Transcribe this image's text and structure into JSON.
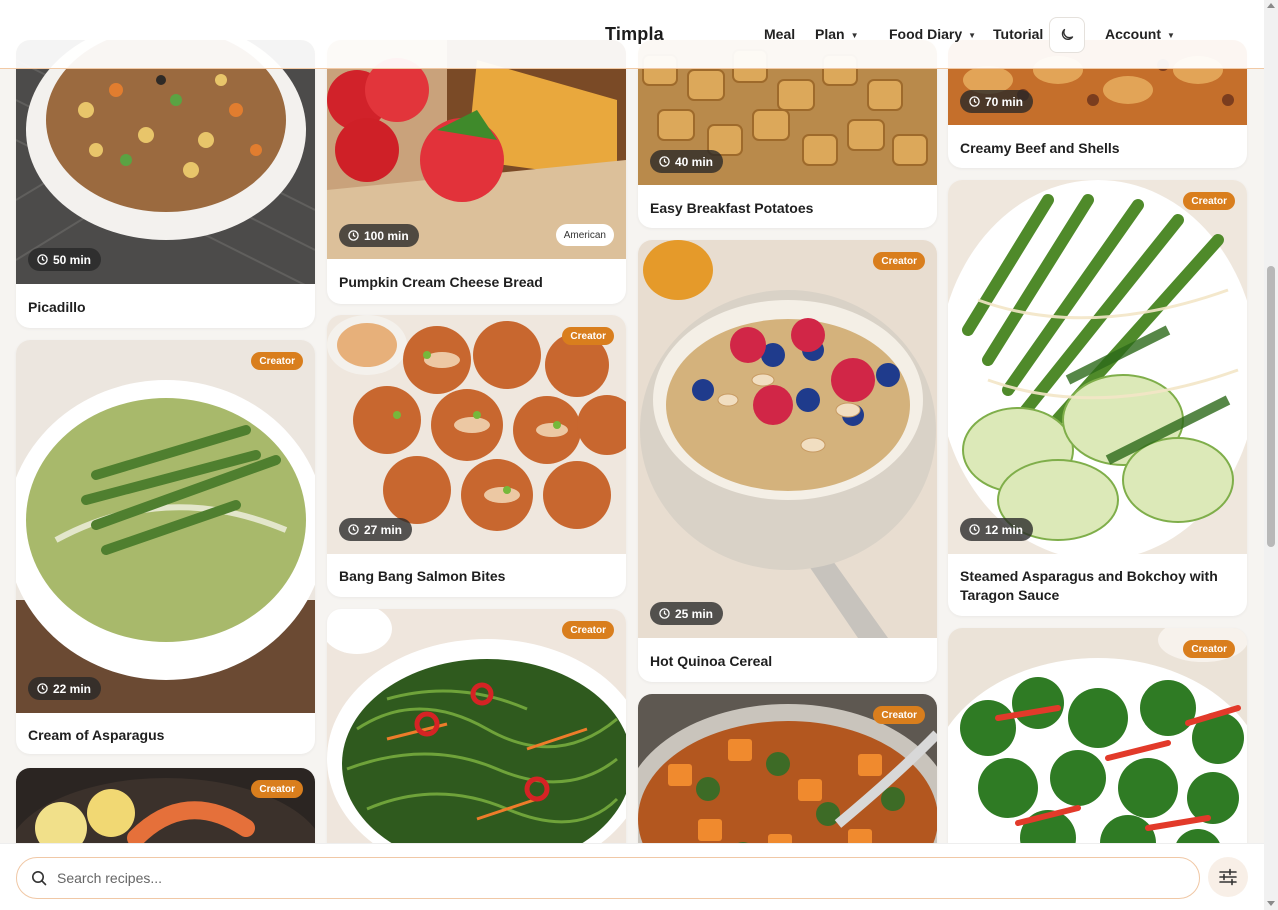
{
  "header": {
    "brand": "Timpla",
    "nav": {
      "meal": "Meal",
      "plan": "Plan",
      "food_diary": "Food Diary",
      "tutorial": "Tutorial",
      "account": "Account"
    },
    "theme_icon": "moon-icon"
  },
  "recipes": [
    {
      "title": "Picadillo",
      "time": "50 min"
    },
    {
      "title": "Cream of Asparagus",
      "time": "22 min",
      "badge": "Creator"
    },
    {
      "title": "",
      "badge": "Creator"
    },
    {
      "title": "Pumpkin Cream Cheese Bread",
      "time": "100 min",
      "cuisine": "American"
    },
    {
      "title": "Bang Bang Salmon Bites",
      "time": "27 min",
      "badge": "Creator"
    },
    {
      "title": "",
      "badge": "Creator"
    },
    {
      "title": "Easy Breakfast Potatoes",
      "time": "40 min"
    },
    {
      "title": "Hot Quinoa Cereal",
      "time": "25 min",
      "badge": "Creator"
    },
    {
      "title": "",
      "badge": "Creator"
    },
    {
      "title": "Creamy Beef and Shells",
      "time": "70 min"
    },
    {
      "title": "Steamed Asparagus and Bokchoy with Taragon Sauce",
      "time": "12 min",
      "badge": "Creator"
    },
    {
      "title": "",
      "badge": "Creator"
    }
  ],
  "search": {
    "placeholder": "Search recipes...",
    "icon": "search-icon",
    "filter_icon": "sliders-icon"
  },
  "colors": {
    "accent": "#d97e1d",
    "border_accent": "#f1c9a5"
  }
}
